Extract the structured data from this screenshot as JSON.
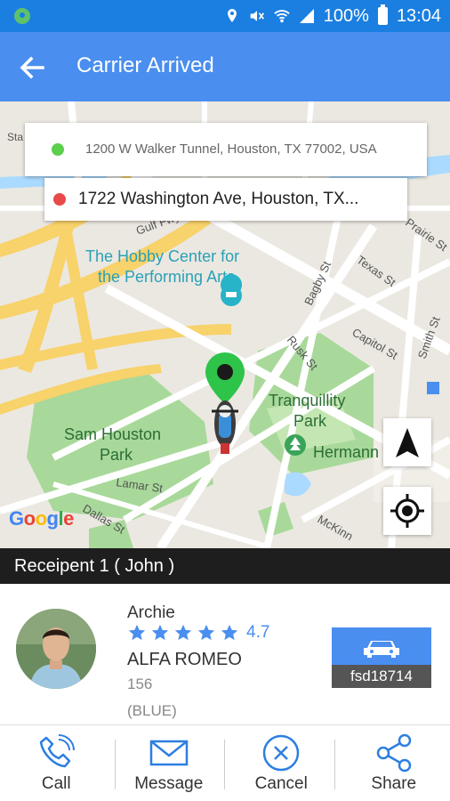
{
  "status_bar": {
    "battery": "100%",
    "time": "13:04",
    "icons": [
      "location-icon",
      "mute-icon",
      "wifi-icon",
      "signal-icon",
      "battery-icon"
    ]
  },
  "app_bar": {
    "title": "Carrier Arrived",
    "back_icon": "arrow-back-icon"
  },
  "map": {
    "from_address": "1200 W Walker Tunnel, Houston, TX 77002, USA",
    "to_address": "1722 Washington Ave, Houston, TX...",
    "labels": {
      "hobby_center": "The Hobby Center for the Performing Arts",
      "hobby_line1": "The Hobby Center for",
      "hobby_line2": "the Performing Arts",
      "tranquillity_line1": "Tranquillity",
      "tranquillity_line2": "Park",
      "sam_houston_line1": "Sam Houston",
      "sam_houston_line2": "Park",
      "hermann": "Hermann",
      "lamar": "Lamar St",
      "dallas": "Dallas St",
      "gulf_fwy": "Gulf Fwy",
      "bagby": "Bagby St",
      "texas": "Texas St",
      "prairie": "Prairie St",
      "capitol": "Capitol St",
      "rusk": "Rusk St",
      "smith": "Smith St",
      "mckinney": "McKinn",
      "sta": "Sta"
    },
    "attribution": "Google",
    "colors": {
      "from_dot": "#5ccf4e",
      "to_dot": "#e84a4a",
      "pin": "#2ec44a"
    }
  },
  "recipient": {
    "label": "Receipent 1 ( John )"
  },
  "driver": {
    "name": "Archie",
    "rating": "4.7",
    "stars": 5,
    "car_model": "ALFA ROMEO",
    "car_number": "156",
    "car_color": "(BLUE)",
    "plate": "fsd18714"
  },
  "actions": [
    {
      "label": "Call",
      "icon": "phone-icon"
    },
    {
      "label": "Message",
      "icon": "envelope-icon"
    },
    {
      "label": "Cancel",
      "icon": "close-circle-icon"
    },
    {
      "label": "Share",
      "icon": "share-icon"
    }
  ],
  "accent_color": "#4a8ef0"
}
